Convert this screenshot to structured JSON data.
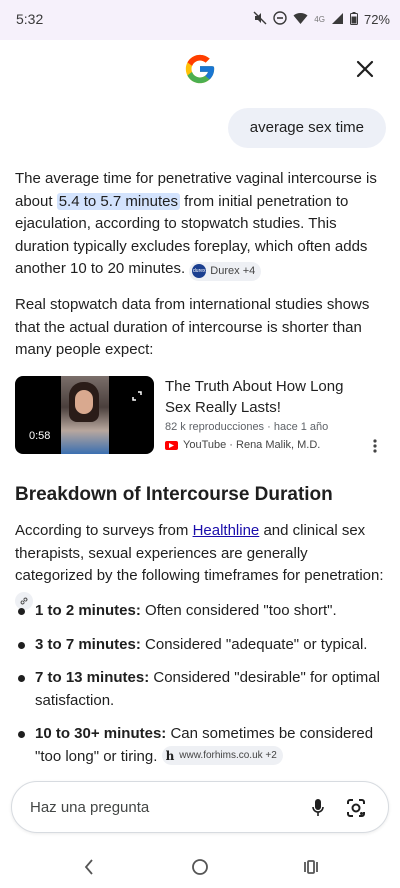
{
  "status_bar": {
    "time": "5:32",
    "network": "4G",
    "battery": "72%"
  },
  "query": "average sex time",
  "answer": {
    "p1_before": "The average time for penetrative vaginal intercourse is about ",
    "p1_highlight": "5.4 to 5.7 minutes",
    "p1_after": " from initial penetration to ejaculation, according to stopwatch studies. This duration typically excludes foreplay, which often adds another 10 to 20 minutes.",
    "p1_chip_logo": "durex",
    "p1_chip": "Durex +4",
    "p2": "Real stopwatch data from international studies shows that the actual duration of intercourse is shorter than many people expect:"
  },
  "video": {
    "duration": "0:58",
    "title": "The Truth About How Long Sex Really Lasts!",
    "meta": "82 k reproducciones · hace 1 año",
    "source": "YouTube · Rena Malik, M.D."
  },
  "section": {
    "heading": "Breakdown of Intercourse Duration",
    "intro_before": "According to surveys from ",
    "intro_link": "Healthline",
    "intro_after": " and clinical sex therapists, sexual experiences are generally categorized by the following timeframes for penetration:"
  },
  "bullets": [
    {
      "bold": "1 to 2 minutes:",
      "text": " Often considered \"too short\"."
    },
    {
      "bold": "3 to 7 minutes:",
      "text": " Considered \"adequate\" or typical."
    },
    {
      "bold": "7 to 13 minutes:",
      "text": " Considered \"desirable\" for optimal satisfaction."
    },
    {
      "bold": "10 to 30+ minutes:",
      "text": " Can sometimes be considered \"too long\" or tiring.",
      "chip": "www.forhims.co.uk +2",
      "chip_letter": "h"
    }
  ],
  "ask_bar": {
    "placeholder": "Haz una pregunta"
  },
  "colors": {
    "highlight": "#d3e3fd",
    "link": "#1a0dab",
    "status_bar_bg": "#f6f1fb",
    "youtube_red": "#ff0000"
  },
  "icons": [
    "google-logo-icon",
    "close-icon",
    "link-icon",
    "youtube-icon",
    "more-vert-icon",
    "mic-icon",
    "lens-icon",
    "back-icon",
    "home-icon",
    "recents-icon"
  ]
}
